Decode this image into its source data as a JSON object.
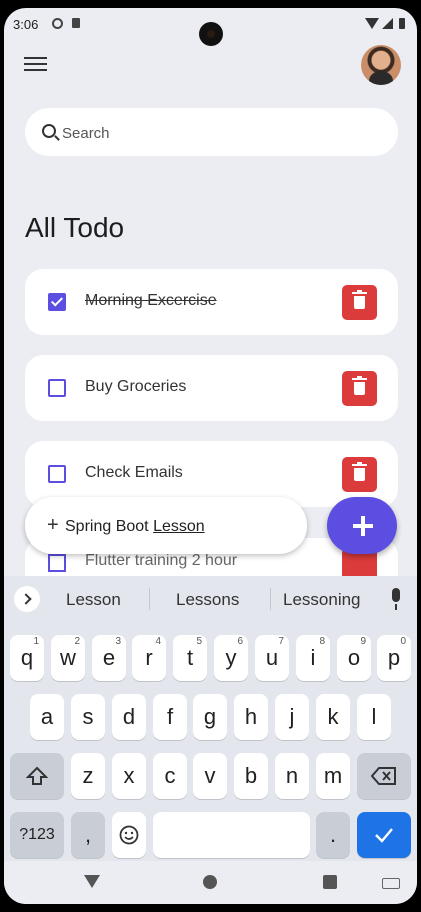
{
  "status_bar": {
    "time": "3:06"
  },
  "search": {
    "placeholder": "Search"
  },
  "page_title": "All Todo",
  "todos": [
    {
      "label": "Morning Excercise",
      "done": true
    },
    {
      "label": "Buy Groceries",
      "done": false
    },
    {
      "label": "Check Emails",
      "done": false
    },
    {
      "label": "Flutter training 2 hour",
      "done": false
    }
  ],
  "add_chip": {
    "prefix": "Spring Boot ",
    "underlined": "Lesson"
  },
  "keyboard": {
    "suggestions": [
      "Lesson",
      "Lessons",
      "Lessoning"
    ],
    "row1": [
      "q",
      "w",
      "e",
      "r",
      "t",
      "y",
      "u",
      "i",
      "o",
      "p"
    ],
    "row1_hints": [
      "1",
      "2",
      "3",
      "4",
      "5",
      "6",
      "7",
      "8",
      "9",
      "0"
    ],
    "row2": [
      "a",
      "s",
      "d",
      "f",
      "g",
      "h",
      "j",
      "k",
      "l"
    ],
    "row3": [
      "z",
      "x",
      "c",
      "v",
      "b",
      "n",
      "m"
    ],
    "symbols_label": "?123",
    "comma": ",",
    "period": "."
  },
  "colors": {
    "accent": "#5b4ee0",
    "delete": "#dc3b3b",
    "enter": "#1e73e6"
  }
}
